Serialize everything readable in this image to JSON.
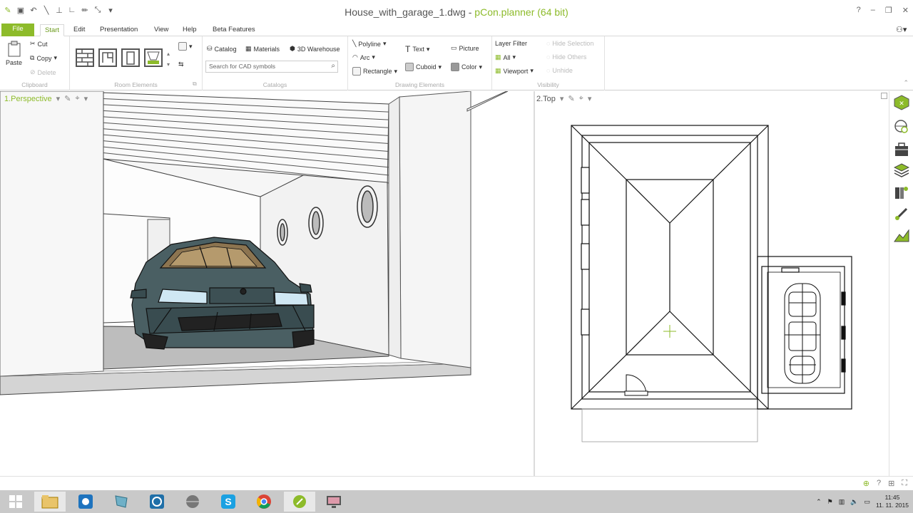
{
  "window": {
    "file_name": "House_with_garage_1.dwg",
    "separator": " - ",
    "app_name": "pCon.planner (64 bit)",
    "controls": [
      "?",
      "–",
      "❐",
      "✕"
    ]
  },
  "menu": {
    "tabs": [
      "File",
      "Start",
      "Edit",
      "Presentation",
      "View",
      "Help",
      "Beta Features"
    ],
    "active": "Start",
    "user_icon": "user-icon"
  },
  "ribbon": {
    "clipboard": {
      "label": "Clipboard",
      "paste": "Paste",
      "cut": "Cut",
      "copy": "Copy",
      "delete": "Delete"
    },
    "room_elements": {
      "label": "Room Elements"
    },
    "catalogs": {
      "label": "Catalogs",
      "catalog": "Catalog",
      "materials": "Materials",
      "warehouse": "3D Warehouse",
      "search_placeholder": "Search for CAD symbols"
    },
    "drawing": {
      "label": "Drawing Elements",
      "polyline": "Polyline",
      "arc": "Arc",
      "rectangle": "Rectangle",
      "text": "Text",
      "cuboid": "Cuboid",
      "picture": "Picture",
      "color": "Color"
    },
    "visibility": {
      "label": "Visibility",
      "layer_filter": "Layer Filter",
      "all": "All",
      "viewport": "Viewport",
      "hide_selection": "Hide Selection",
      "hide_others": "Hide Others",
      "unhide": "Unhide"
    }
  },
  "viewports": {
    "perspective": {
      "label": "1.Perspective",
      "dropdown": "▾"
    },
    "top": {
      "label": "2.Top",
      "dropdown": "▾"
    }
  },
  "taskbar": {
    "clock_time": "11:45",
    "clock_date": "11. 11. 2015"
  },
  "colors": {
    "accent": "#8dbb2a",
    "car_body": "#4a5f63",
    "headlight": "#cfe7f3"
  }
}
